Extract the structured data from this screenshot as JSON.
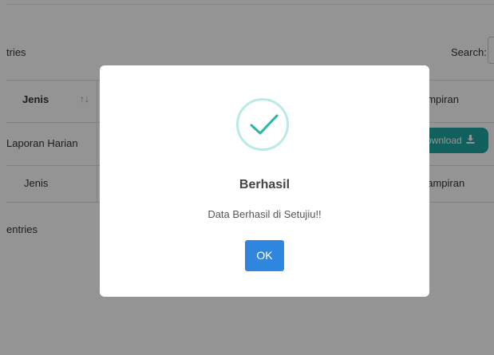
{
  "table": {
    "show_entries_top": "tries",
    "search_label": "Search:",
    "col_jenis": "Jenis",
    "sort_icon": "↑↓",
    "col_lampiran": "ampiran",
    "row_jenis": "Laporan Harian",
    "download_label": "ownload",
    "download_icon": "download-icon",
    "footer_jenis": "Jenis",
    "footer_lampiran": "Lampiran",
    "show_entries_bottom": "entries"
  },
  "modal": {
    "icon": "check-icon",
    "title": "Berhasil",
    "message": "Data Berhasil di Setujiu!!",
    "ok_label": "OK"
  },
  "colors": {
    "accent_teal": "#1fa6a0",
    "ok_blue": "#2e86de",
    "check_green": "#2bb5a6",
    "title_red": "#e03030"
  }
}
